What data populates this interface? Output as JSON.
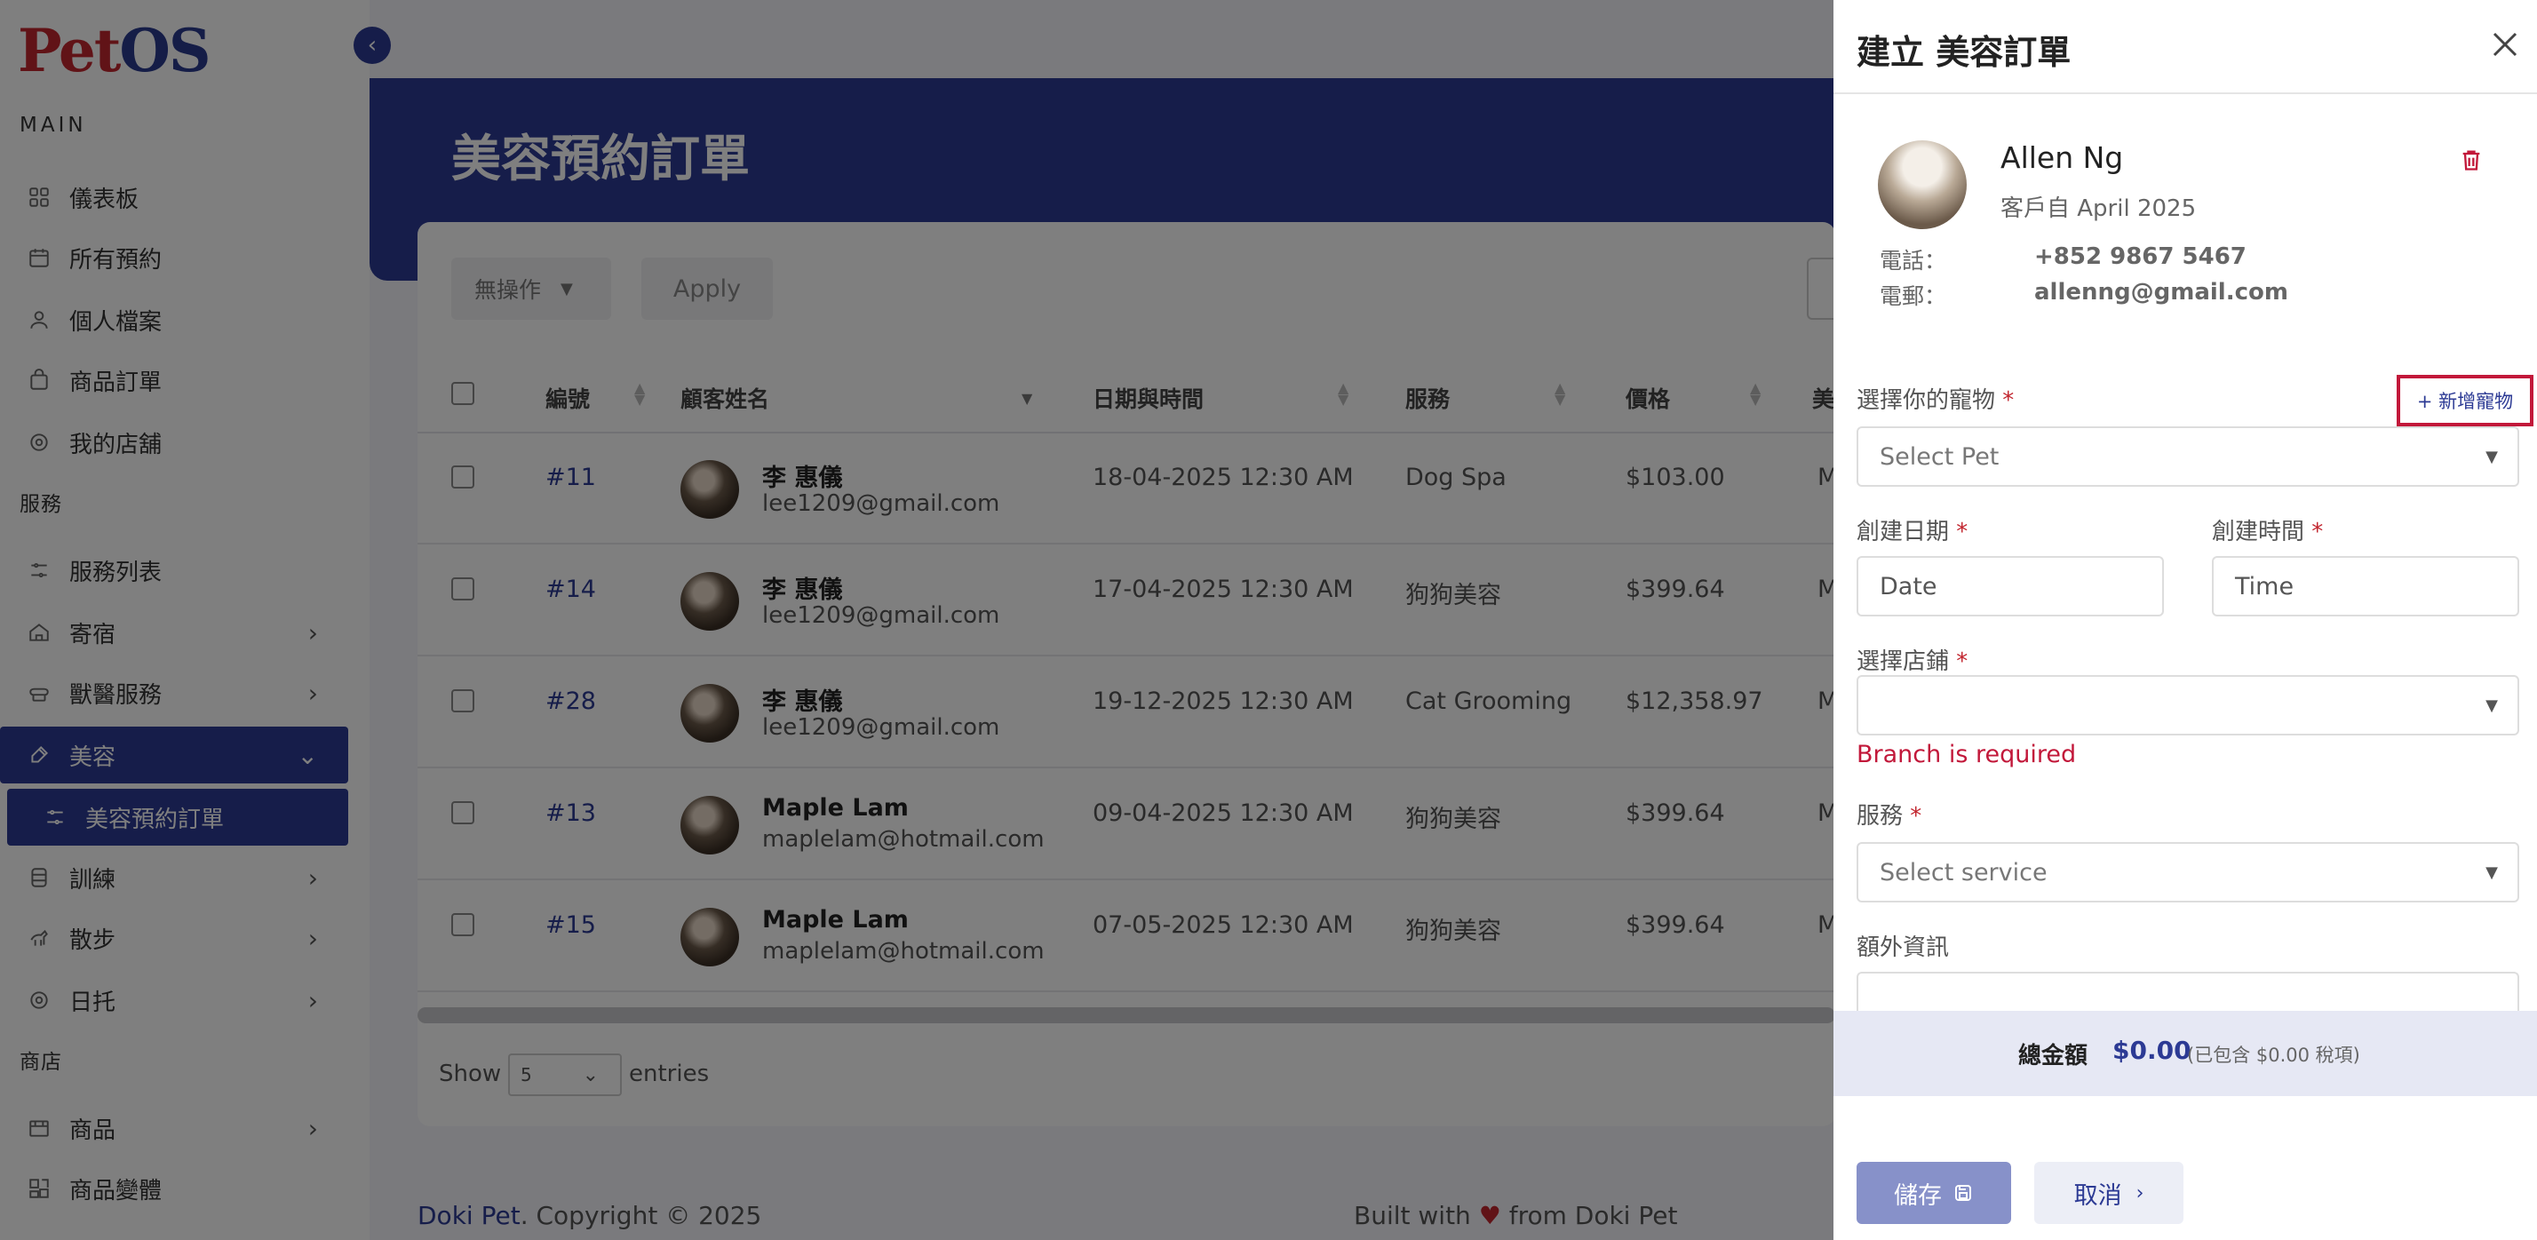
{
  "logo": {
    "pet": "Pet",
    "os": "OS"
  },
  "sidebar": {
    "main_title": "MAIN",
    "service_title": "服務",
    "shop_title": "商店",
    "items": [
      {
        "label": "儀表板",
        "icon": "grid-icon"
      },
      {
        "label": "所有預約",
        "icon": "calendar-icon"
      },
      {
        "label": "個人檔案",
        "icon": "user-icon"
      },
      {
        "label": "商品訂單",
        "icon": "bag-icon"
      },
      {
        "label": "我的店舖",
        "icon": "shop-icon"
      },
      {
        "label": "服務列表",
        "icon": "list-icon"
      },
      {
        "label": "寄宿",
        "icon": "home-icon"
      },
      {
        "label": "獸醫服務",
        "icon": "stethoscope-icon"
      },
      {
        "label": "美容",
        "icon": "brush-icon"
      },
      {
        "label": "美容預約訂單",
        "icon": "list-icon"
      },
      {
        "label": "訓練",
        "icon": "training-icon"
      },
      {
        "label": "散步",
        "icon": "walk-icon"
      },
      {
        "label": "日托",
        "icon": "daycare-icon"
      },
      {
        "label": "商品",
        "icon": "box-icon"
      },
      {
        "label": "商品變體",
        "icon": "variant-icon"
      }
    ]
  },
  "page": {
    "title": "美容預約訂單"
  },
  "toolbar": {
    "bulk_action": "無操作",
    "apply": "Apply"
  },
  "table": {
    "headers": {
      "id": "編號",
      "name": "顧客姓名",
      "datetime": "日期與時間",
      "service": "服務",
      "price": "價格",
      "extra": "美"
    },
    "rows": [
      {
        "id": "#11",
        "name": "李 惠儀",
        "email": "lee1209@gmail.com",
        "datetime": "18-04-2025 12:30 AM",
        "service": "Dog Spa",
        "price": "$103.00",
        "extra": "M"
      },
      {
        "id": "#14",
        "name": "李 惠儀",
        "email": "lee1209@gmail.com",
        "datetime": "17-04-2025 12:30 AM",
        "service": "狗狗美容",
        "price": "$399.64",
        "extra": "M"
      },
      {
        "id": "#28",
        "name": "李 惠儀",
        "email": "lee1209@gmail.com",
        "datetime": "19-12-2025 12:30 AM",
        "service": "Cat Grooming",
        "price": "$12,358.97",
        "extra": "M"
      },
      {
        "id": "#13",
        "name": "Maple Lam",
        "email": "maplelam@hotmail.com",
        "datetime": "09-04-2025 12:30 AM",
        "service": "狗狗美容",
        "price": "$399.64",
        "extra": "M"
      },
      {
        "id": "#15",
        "name": "Maple Lam",
        "email": "maplelam@hotmail.com",
        "datetime": "07-05-2025 12:30 AM",
        "service": "狗狗美容",
        "price": "$399.64",
        "extra": "M"
      }
    ]
  },
  "pagination": {
    "show": "Show",
    "value": "5",
    "entries": "entries"
  },
  "footer": {
    "brand": "Doki Pet",
    "copyright": ". Copyright © 2025",
    "built_with": "Built with",
    "heart": "♥",
    "built_from": "from Doki Pet"
  },
  "drawer": {
    "title": "建立 美容訂單",
    "customer": {
      "name": "Allen Ng",
      "since": "客戶自 April 2025",
      "phone_label": "電話：",
      "phone": "+852 9867 5467",
      "email_label": "電郵：",
      "email": "allenng@gmail.com"
    },
    "pet_label": "選擇你的寵物",
    "add_pet": "+ 新增寵物",
    "pet_placeholder": "Select Pet",
    "date_label": "創建日期",
    "date_placeholder": "Date",
    "time_label": "創建時間",
    "time_placeholder": "Time",
    "branch_label": "選擇店鋪",
    "branch_value": "",
    "branch_error": "Branch is required",
    "service_label": "服務",
    "service_placeholder": "Select service",
    "extra_label": "額外資訊",
    "required_mark": "*",
    "total_label": "總金額",
    "total_amount": "$0.00",
    "total_tax": "(已包含 $0.00 稅項)",
    "save": "儲存",
    "cancel": "取消"
  },
  "colors": {
    "primary": "#2c3a94",
    "danger": "#c2183a",
    "overlay": "rgba(0,0,0,0.5)"
  }
}
